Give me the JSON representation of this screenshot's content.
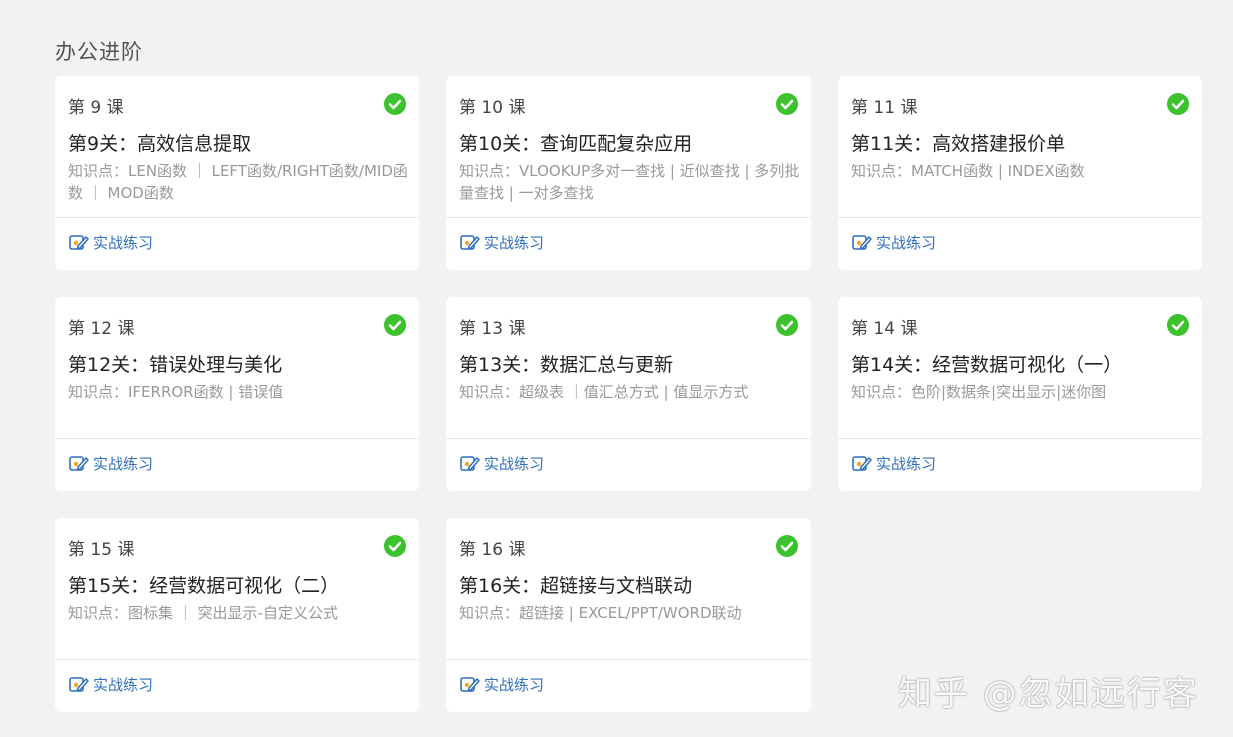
{
  "section": {
    "title": "办公进阶"
  },
  "colors": {
    "check": "#3bc22d",
    "link": "#2f6fbf",
    "background": "#f2f2f2"
  },
  "icons": {
    "completed": "check-circle-icon",
    "practice": "practice-edit-icon"
  },
  "cards": [
    {
      "lesson": "第 9 课",
      "title": "第9关：高效信息提取",
      "knowledge": "知识点：LEN函数 ｜ LEFT函数/RIGHT函数/MID函数 ｜ MOD函数",
      "practice": "实战练习"
    },
    {
      "lesson": "第 10 课",
      "title": "第10关：查询匹配复杂应用",
      "knowledge": "知识点：VLOOKUP多对一查找 | 近似查找 | 多列批量查找 | 一对多查找",
      "practice": "实战练习"
    },
    {
      "lesson": "第 11 课",
      "title": "第11关：高效搭建报价单",
      "knowledge": "知识点：MATCH函数 | INDEX函数",
      "practice": "实战练习"
    },
    {
      "lesson": "第 12 课",
      "title": "第12关：错误处理与美化",
      "knowledge": "知识点：IFERROR函数 | 错误值",
      "practice": "实战练习"
    },
    {
      "lesson": "第 13 课",
      "title": "第13关：数据汇总与更新",
      "knowledge": "知识点：超级表 ｜值汇总方式 | 值显示方式",
      "practice": "实战练习"
    },
    {
      "lesson": "第 14 课",
      "title": "第14关：经营数据可视化（一）",
      "knowledge": "知识点：色阶|数据条|突出显示|迷你图",
      "practice": "实战练习"
    },
    {
      "lesson": "第 15 课",
      "title": "第15关：经营数据可视化（二）",
      "knowledge": "知识点：图标集 ｜ 突出显示-自定义公式",
      "practice": "实战练习"
    },
    {
      "lesson": "第 16 课",
      "title": "第16关：超链接与文档联动",
      "knowledge": "知识点：超链接 | EXCEL/PPT/WORD联动",
      "practice": "实战练习"
    }
  ],
  "watermark": "知乎 @忽如远行客"
}
